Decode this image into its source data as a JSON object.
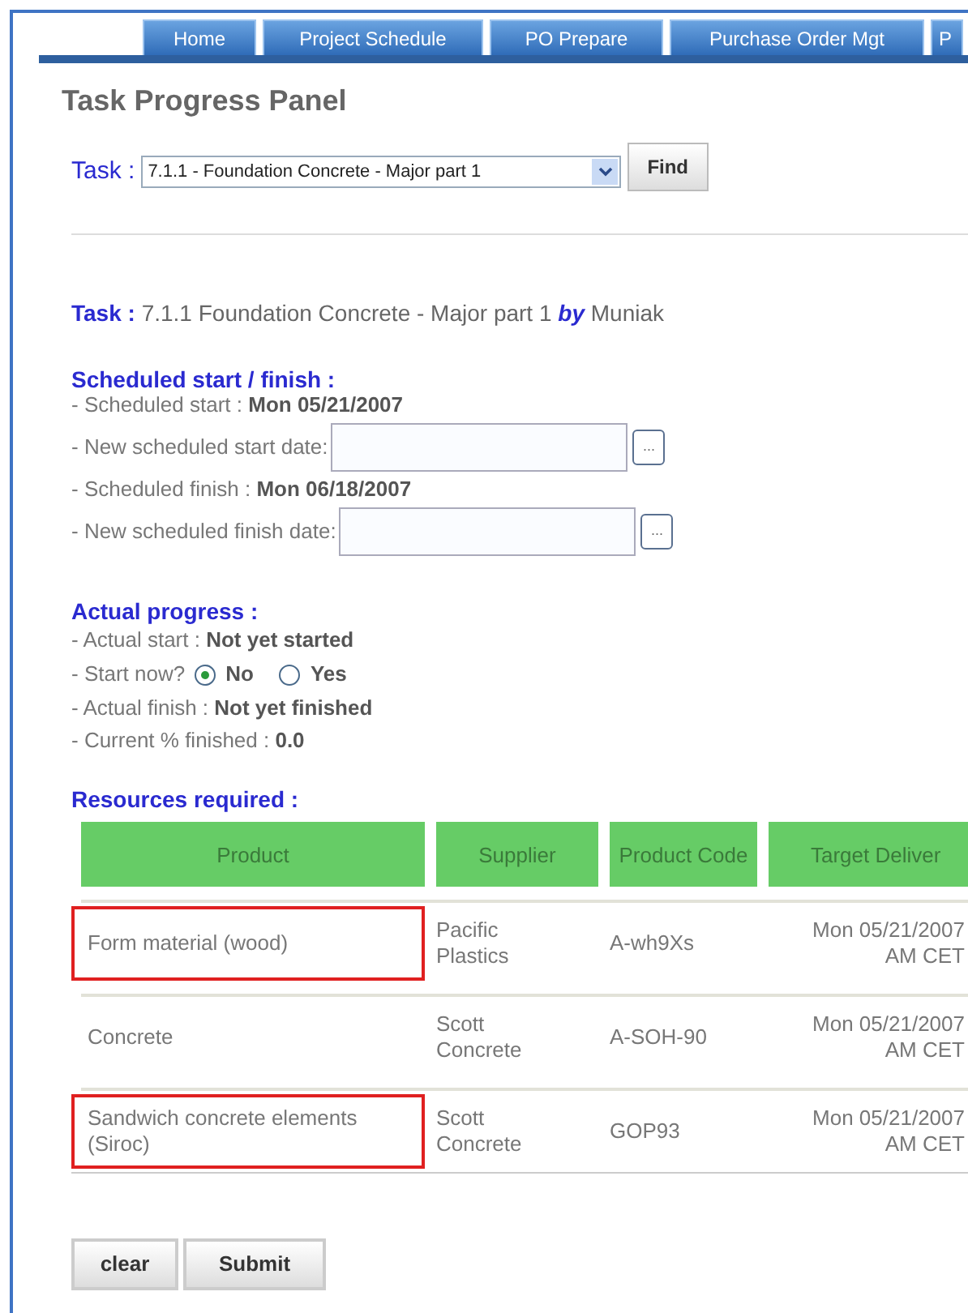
{
  "nav_tabs": [
    {
      "label": "Home"
    },
    {
      "label": "Project Schedule"
    },
    {
      "label": "PO Prepare"
    },
    {
      "label": "Purchase Order Mgt"
    },
    {
      "label": "P"
    }
  ],
  "title": "Task Progress Panel",
  "task_selector": {
    "label": "Task :",
    "value": "7.1.1 - Foundation Concrete - Major part 1",
    "button": "Find"
  },
  "task_info": {
    "label": "Task :",
    "text": "7.1.1 Foundation Concrete - Major part 1",
    "by": "by",
    "owner": "Muniak"
  },
  "scheduled": {
    "heading": "Scheduled start / finish :",
    "lines": [
      {
        "kind": "value",
        "label": "- Scheduled start : ",
        "value": "Mon 05/21/2007"
      },
      {
        "kind": "date_input",
        "label": "- New scheduled start date:",
        "button": "..."
      },
      {
        "kind": "value",
        "label": "- Scheduled finish : ",
        "value": "Mon 06/18/2007"
      },
      {
        "kind": "date_input",
        "label": "- New scheduled finish date:",
        "button": "..."
      }
    ]
  },
  "progress": {
    "heading": "Actual progress :",
    "lines": [
      {
        "kind": "value",
        "label": "- Actual start : ",
        "value": "Not yet started"
      },
      {
        "kind": "radio",
        "label": "- Start now?",
        "options": [
          {
            "label": "No",
            "selected": true
          },
          {
            "label": "Yes",
            "selected": false
          }
        ]
      },
      {
        "kind": "value",
        "label": "- Actual finish : ",
        "value": "Not yet finished"
      },
      {
        "kind": "value",
        "label": "- Current % finished : ",
        "value": "0.0"
      }
    ]
  },
  "resources": {
    "heading": "Resources required :",
    "columns": [
      "Product",
      "Supplier",
      "Product Code",
      "Target Deliver"
    ],
    "rows": [
      {
        "highlighted": true,
        "cells": [
          "Form material (wood)",
          "Pacific Plastics",
          "A-wh9Xs",
          [
            "Mon 05/21/2007",
            "AM CET"
          ]
        ]
      },
      {
        "highlighted": false,
        "cells": [
          "Concrete",
          "Scott Concrete",
          "A-SOH-90",
          [
            "Mon 05/21/2007",
            "AM CET"
          ]
        ]
      },
      {
        "highlighted": true,
        "cells": [
          "Sandwich concrete elements (Siroc)",
          "Scott Concrete",
          "GOP93",
          [
            "Mon 05/21/2007",
            "AM CET"
          ]
        ]
      }
    ]
  },
  "buttons": [
    "clear",
    "Submit"
  ]
}
